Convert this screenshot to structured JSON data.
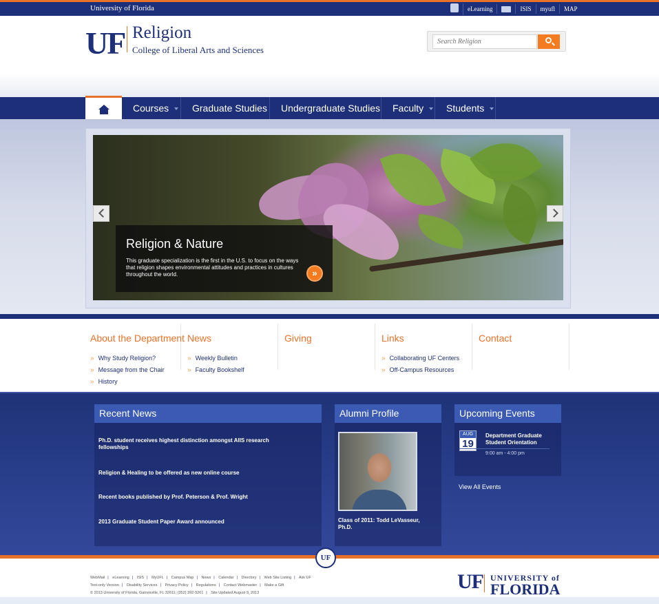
{
  "topbar": {
    "university_link": "University of Florida",
    "tools": [
      "eLearning",
      "ISIS",
      "myufl",
      "MAP"
    ]
  },
  "header": {
    "logo_mark": "UF",
    "department": "Religion",
    "college": "College of Liberal Arts and Sciences",
    "search": {
      "placeholder": "Search Religion",
      "icon": "search-icon"
    }
  },
  "nav": {
    "home_icon": "home-icon",
    "items": [
      {
        "label": "Courses"
      },
      {
        "label": "Graduate Studies"
      },
      {
        "label": "Undergraduate Studies"
      },
      {
        "label": "Faculty"
      },
      {
        "label": "Students"
      }
    ]
  },
  "hero": {
    "title": "Religion & Nature",
    "text": "This graduate specialization is the first in the U.S. to focus on the ways that religion shapes environmental attitudes and practices in cultures throughout the world.",
    "more_glyph": "»"
  },
  "quicklinks": [
    {
      "heading": "About the Department",
      "links": [
        "Why Study Religion?",
        "Message from the Chair",
        "History"
      ]
    },
    {
      "heading": "News",
      "links": [
        "Weekly Bulletin",
        "Faculty Bookshelf"
      ]
    },
    {
      "heading": "Giving",
      "links": []
    },
    {
      "heading": "Links",
      "links": [
        "Collaborating UF Centers",
        "Off-Campus Resources"
      ]
    },
    {
      "heading": "Contact",
      "links": []
    }
  ],
  "recent_news": {
    "heading": "Recent News",
    "items": [
      "Ph.D. student receives highest distinction amongst AIIS research fellowships",
      "Religion & Healing to be offered as new online course",
      "Recent books published by Prof. Peterson & Prof. Wright",
      "2013 Graduate Student Paper Award announced"
    ]
  },
  "alumni": {
    "heading": "Alumni Profile",
    "caption": "Class of 2011: Todd LeVasseur, Ph.D."
  },
  "events": {
    "heading": "Upcoming Events",
    "month": "AUG",
    "day": "19",
    "title": "Department Graduate Student Orientation",
    "time": "9:00 am - 4:00 pm",
    "view_all": "View All Events"
  },
  "footer": {
    "seal": "UF",
    "links_row1": [
      "WebMail",
      "eLearning",
      "ISIS",
      "MyUFL",
      "Campus Map",
      "News",
      "Calendar",
      "Directory",
      "Web Site Listing",
      "Ask UF"
    ],
    "links_row2": [
      "Text-only Version",
      "Disability Services",
      "Privacy Policy",
      "Regulations",
      "Contact Webmaster",
      "Make a Gift"
    ],
    "copyright": "© 2013 University of Florida, Gainesville, FL 32611; (352) 392-3261",
    "updated": "Site Updated August 9, 2013",
    "logo_mark": "UF",
    "logo_univ": "UNIVERSITY of",
    "logo_state": "FLORIDA"
  },
  "colors": {
    "brand_blue": "#1d2f78",
    "brand_orange": "#e8722a",
    "panel_blue": "#3a5ab4"
  }
}
